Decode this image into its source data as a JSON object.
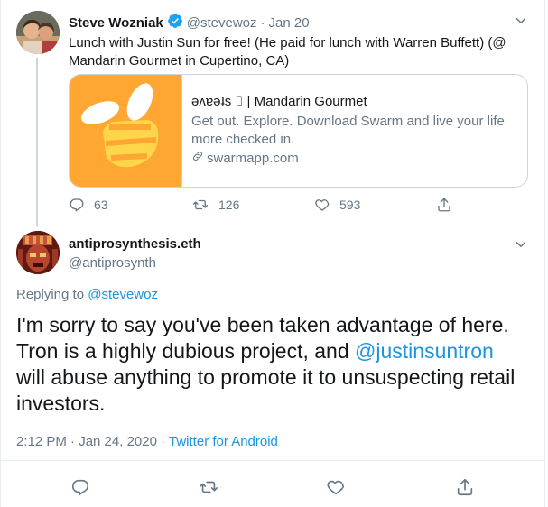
{
  "parent": {
    "name": "Steve Wozniak",
    "handle": "@stevewoz",
    "separator": "·",
    "date": "Jan 20",
    "text": "Lunch with Justin Sun for free! (He paid for lunch with Warren Buffett) (@ Mandarin Gourmet in Cupertino, CA)",
    "card": {
      "title": "ǝʌɐǝʇs ⌷ | Mandarin Gourmet",
      "description": "Get out. Explore. Download Swarm and live your life more checked in.",
      "link": "swarmapp.com",
      "thumb_color": "#ffa633"
    },
    "stats": {
      "replies": "63",
      "retweets": "126",
      "likes": "593"
    }
  },
  "reply": {
    "name": "antiprosynthesis.eth",
    "handle": "@antiprosynth",
    "replying_prefix": "Replying to",
    "replying_to": "@stevewoz",
    "text_part1": "I'm sorry to say you've been taken advantage of here. Tron is a highly dubious project, and",
    "mention": "@justinsuntron",
    "text_part2": "will abuse anything to promote it to unsuspecting retail investors.",
    "timestamp": "2:12 PM · Jan 24, 2020 ·",
    "client": "Twitter for Android"
  },
  "icons": [
    "verified-badge-icon",
    "chevron-down-icon",
    "reply-icon",
    "retweet-icon",
    "like-icon",
    "share-icon",
    "link-icon",
    "swarm-bee-icon"
  ],
  "colors": {
    "accent": "#1b95e0",
    "secondary_text": "#657786",
    "border": "#ccd6dd",
    "swarm_orange": "#ffa633"
  }
}
